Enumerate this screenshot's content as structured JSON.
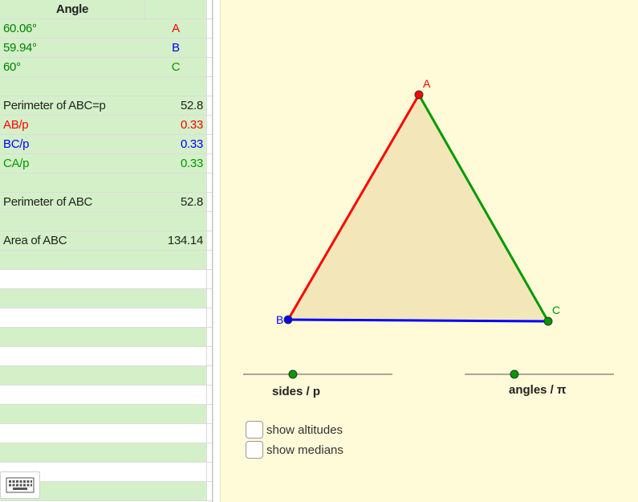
{
  "spreadsheet": {
    "rows": [
      {
        "a": "Angle",
        "b": "",
        "a_center": true,
        "a_bold": true,
        "a_color": "#222222",
        "b_color": "#222222",
        "bg": "green"
      },
      {
        "a": "60.06°",
        "b": "A",
        "a_color": "#007f00",
        "b_color": "#ff0000",
        "b_center": true,
        "bg": "green"
      },
      {
        "a": "59.94°",
        "b": "B",
        "a_color": "#007f00",
        "b_color": "#0000ff",
        "b_center": true,
        "bg": "green"
      },
      {
        "a": "60°",
        "b": "C",
        "a_color": "#007f00",
        "b_color": "#009900",
        "b_center": true,
        "bg": "green"
      },
      {
        "a": "",
        "b": "",
        "bg": "green"
      },
      {
        "a": "Perimeter of ABC=p",
        "b": "52.8",
        "a_color": "#222222",
        "b_color": "#222222",
        "bg": "green"
      },
      {
        "a": "AB/p",
        "b": "0.33",
        "a_color": "#ff0000",
        "b_color": "#ff0000",
        "bg": "green"
      },
      {
        "a": "BC/p",
        "b": "0.33",
        "a_color": "#0000ff",
        "b_color": "#0000ff",
        "bg": "green"
      },
      {
        "a": "CA/p",
        "b": "0.33",
        "a_color": "#009900",
        "b_color": "#009900",
        "bg": "green"
      },
      {
        "a": "",
        "b": "",
        "bg": "green"
      },
      {
        "a": "Perimeter of ABC",
        "b": "52.8",
        "a_color": "#222222",
        "b_color": "#222222",
        "bg": "green"
      },
      {
        "a": "",
        "b": "",
        "bg": "green"
      },
      {
        "a": "Area of ABC",
        "b": "134.14",
        "a_color": "#222222",
        "b_color": "#222222",
        "bg": "green"
      },
      {
        "a": "",
        "b": "",
        "bg": "green"
      },
      {
        "a": "",
        "b": "",
        "bg": "white"
      },
      {
        "a": "",
        "b": "",
        "bg": "green"
      },
      {
        "a": "",
        "b": "",
        "bg": "white"
      },
      {
        "a": "",
        "b": "",
        "bg": "green"
      },
      {
        "a": "",
        "b": "",
        "bg": "white"
      },
      {
        "a": "",
        "b": "",
        "bg": "green"
      },
      {
        "a": "",
        "b": "",
        "bg": "white"
      },
      {
        "a": "",
        "b": "",
        "bg": "green"
      },
      {
        "a": "",
        "b": "",
        "bg": "white"
      },
      {
        "a": "",
        "b": "",
        "bg": "green"
      },
      {
        "a": "",
        "b": "",
        "bg": "white"
      },
      {
        "a": "",
        "b": "",
        "bg": "green"
      }
    ]
  },
  "graphics": {
    "points": {
      "A": "A",
      "B": "B",
      "C": "C"
    },
    "colors": {
      "ab": "#ff0000",
      "bc": "#0000ff",
      "ca": "#009900",
      "fill": "#f3e7b9",
      "point_a": "#ff0000",
      "point_b": "#0000ff",
      "point_c": "#009900",
      "slider_line": "#555555",
      "slider_knob": "#009900",
      "background": "#fffbd8"
    },
    "sliders": {
      "sides": {
        "label": "sides / p",
        "value": 0.333
      },
      "angles": {
        "label": "angles / π",
        "value": 0.333
      }
    },
    "checkboxes": {
      "altitudes": {
        "label": "show altitudes",
        "checked": false
      },
      "medians": {
        "label": "show medians",
        "checked": false
      }
    }
  },
  "keyboard": {
    "icon": "keyboard-icon"
  }
}
